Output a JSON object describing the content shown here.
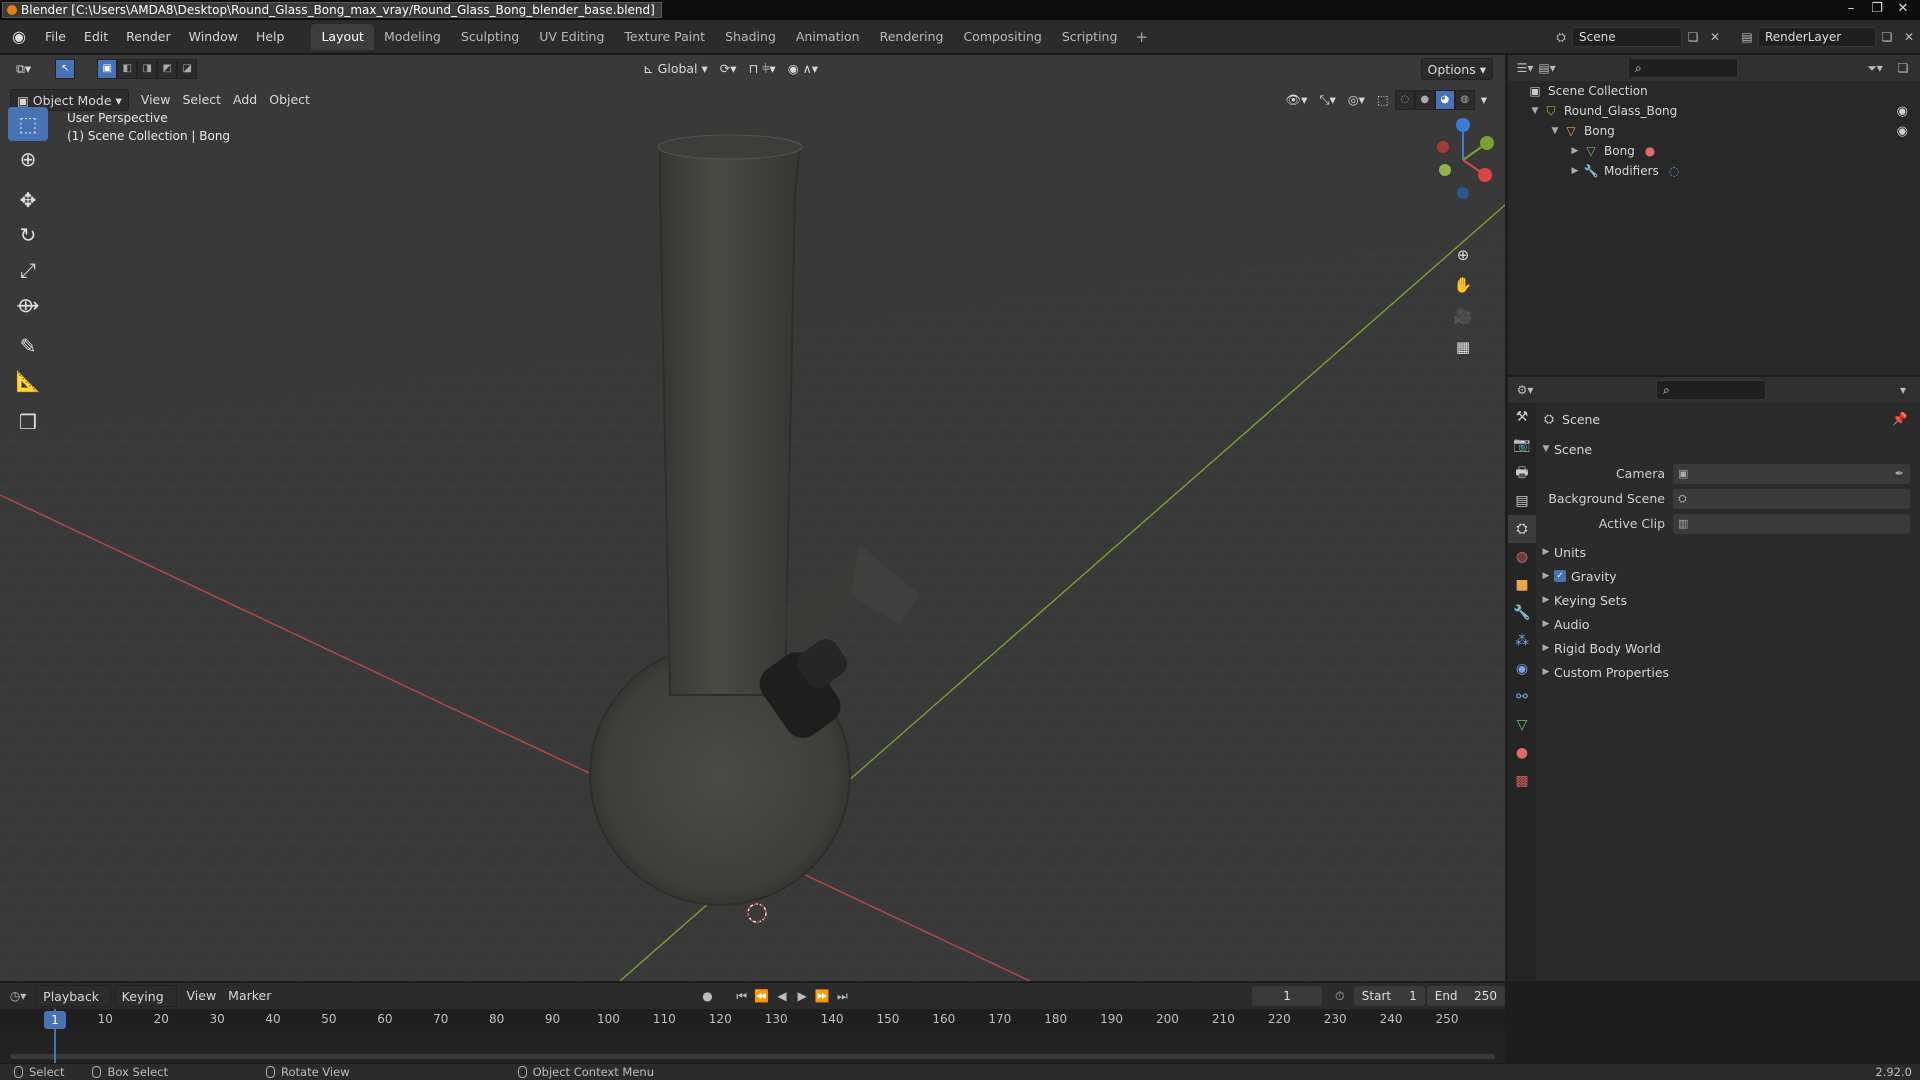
{
  "window": {
    "title": "Blender [C:\\Users\\AMDA8\\Desktop\\Round_Glass_Bong_max_vray/Round_Glass_Bong_blender_base.blend]"
  },
  "menu": [
    "File",
    "Edit",
    "Render",
    "Window",
    "Help"
  ],
  "workspaces": [
    "Layout",
    "Modeling",
    "Sculpting",
    "UV Editing",
    "Texture Paint",
    "Shading",
    "Animation",
    "Rendering",
    "Compositing",
    "Scripting"
  ],
  "active_workspace": "Layout",
  "scene_selector": {
    "value": "Scene"
  },
  "view_layer_selector": {
    "value": "RenderLayer"
  },
  "viewport": {
    "mode": "Object Mode",
    "header_menus": [
      "View",
      "Select",
      "Add",
      "Object"
    ],
    "orientation": "Global",
    "options_label": "Options",
    "overlay_line1": "User Perspective",
    "overlay_line2": "(1) Scene Collection | Bong"
  },
  "outliner": {
    "root": "Scene Collection",
    "rows": [
      {
        "label": "Round_Glass_Bong",
        "depth": 1,
        "icon": "collection-icon"
      },
      {
        "label": "Bong",
        "depth": 2,
        "icon": "object-icon"
      },
      {
        "label": "Bong",
        "depth": 3,
        "icon": "mesh-data-icon"
      },
      {
        "label": "Modifiers",
        "depth": 3,
        "icon": "wrench-icon"
      }
    ]
  },
  "properties": {
    "context_title": "Scene",
    "section": "Scene",
    "fields": [
      {
        "label": "Camera"
      },
      {
        "label": "Background Scene"
      },
      {
        "label": "Active Clip"
      }
    ],
    "panels": [
      {
        "label": "Units",
        "checkbox": false
      },
      {
        "label": "Gravity",
        "checkbox": true
      },
      {
        "label": "Keying Sets",
        "checkbox": false
      },
      {
        "label": "Audio",
        "checkbox": false
      },
      {
        "label": "Rigid Body World",
        "checkbox": false
      },
      {
        "label": "Custom Properties",
        "checkbox": false
      }
    ]
  },
  "timeline": {
    "menus": [
      "Playback",
      "Keying",
      "View",
      "Marker"
    ],
    "current_frame": "1",
    "start_label": "Start",
    "start_value": "1",
    "end_label": "End",
    "end_value": "250",
    "ticks": [
      "1",
      "10",
      "20",
      "30",
      "40",
      "50",
      "60",
      "70",
      "80",
      "90",
      "100",
      "110",
      "120",
      "130",
      "140",
      "150",
      "160",
      "170",
      "180",
      "190",
      "200",
      "210",
      "220",
      "230",
      "240",
      "250"
    ]
  },
  "statusbar": {
    "select": "Select",
    "box_select": "Box Select",
    "rotate_view": "Rotate View",
    "context_menu": "Object Context Menu",
    "version": "2.92.0"
  },
  "colors": {
    "accent": "#4772b3",
    "x_axis": "#b84848",
    "y_axis": "#7aa02e",
    "viewport_bg": "#393939"
  }
}
